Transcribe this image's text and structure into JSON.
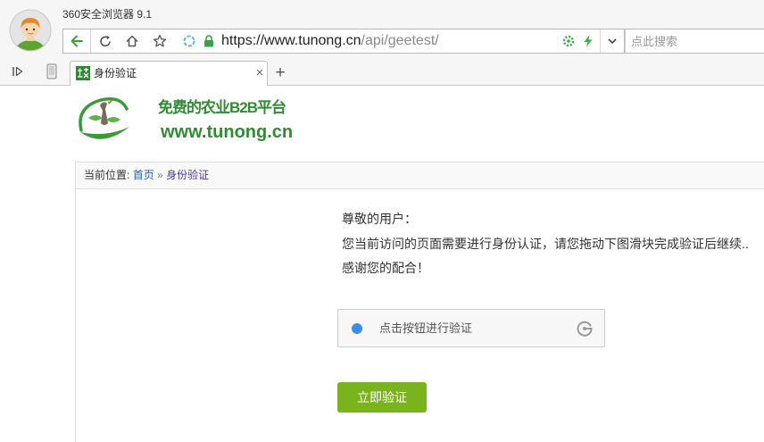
{
  "browser": {
    "title": "360安全浏览器 9.1",
    "address": {
      "host": "https://www.tunong.cn",
      "path": "/api/geetest/"
    },
    "search_placeholder": "点此搜索",
    "tabs": [
      {
        "label": "身份验证",
        "close": "×"
      }
    ],
    "new_tab": "+"
  },
  "page": {
    "logo": {
      "slogan": "免费的农业B2B平台",
      "domain": "www.tunong.cn"
    },
    "breadcrumb": {
      "label": "当前位置:",
      "home": "首页",
      "separator": "»",
      "current": "身份验证"
    },
    "notice": {
      "greeting": "尊敬的用户：",
      "message": "您当前访问的页面需要进行身份认证，请您拖动下图滑块完成验证后继续..",
      "thanks": "感谢您的配合！"
    },
    "captcha": {
      "prompt": "点击按钮进行验证"
    },
    "submit_label": "立即验证"
  },
  "icons": {
    "avatar": "user-avatar-icon",
    "back": "back-arrow-icon",
    "refresh": "refresh-icon",
    "home": "home-icon",
    "favorite": "star-icon",
    "site_security": "security-icon",
    "lock": "lock-icon",
    "speed": "speed-up-icon",
    "lightning": "lightning-icon",
    "dropdown": "chevron-down-icon",
    "sidebar": "sidebar-toggle-icon",
    "mobile": "phone-icon",
    "favicon": "site-favicon-icon",
    "captcha_logo": "geetest-logo-icon"
  },
  "colors": {
    "brand_green": "#2f8c33",
    "button_green": "#79b41c",
    "nav_green": "#3aa338",
    "link_blue": "#1d5fb0",
    "link_visited": "#4b3a9a",
    "captcha_dot": "#3b8ef0"
  }
}
